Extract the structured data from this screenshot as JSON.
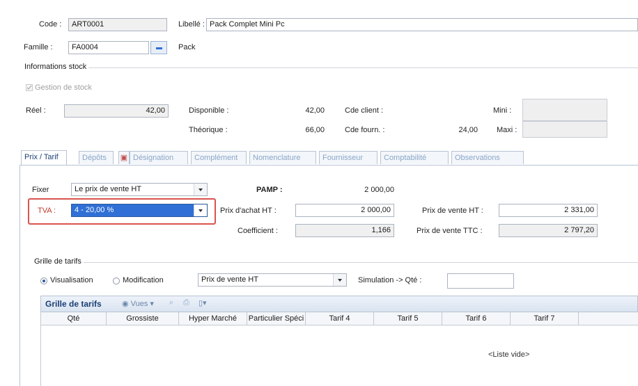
{
  "header": {
    "code_label": "Code :",
    "code_value": "ART0001",
    "libelle_label": "Libellé :",
    "libelle_value": "Pack Complet Mini Pc",
    "famille_label": "Famille :",
    "famille_value": "FA0004",
    "famille_name": "Pack"
  },
  "stock": {
    "title": "Informations stock",
    "gestion_label": "Gestion de stock",
    "reel_label": "Réel :",
    "reel_value": "42,00",
    "disponible_label": "Disponible :",
    "disponible_value": "42,00",
    "theorique_label": "Théorique :",
    "theorique_value": "66,00",
    "cde_client_label": "Cde client :",
    "cde_client_value": "",
    "cde_fourn_label": "Cde fourn. :",
    "cde_fourn_value": "24,00",
    "mini_label": "Mini :",
    "maxi_label": "Maxi :"
  },
  "tabs": [
    "Prix / Tarif",
    "Dépôts",
    "Désignation",
    "Complément",
    "Nomenclature",
    "Fournisseur",
    "Comptabilité",
    "Observations"
  ],
  "prix": {
    "fixer_label": "Fixer",
    "fixer_value": "Le prix de vente HT",
    "tva_label": "TVA :",
    "tva_value": "4 - 20,00 %",
    "pamp_label": "PAMP :",
    "pamp_value": "2 000,00",
    "prix_achat_label": "Prix d'achat HT :",
    "prix_achat_value": "2 000,00",
    "coef_label": "Coefficient :",
    "coef_value": "1,166",
    "pv_ht_label": "Prix de vente HT :",
    "pv_ht_value": "2 331,00",
    "pv_ttc_label": "Prix de vente TTC :",
    "pv_ttc_value": "2 797,20"
  },
  "grille": {
    "title": "Grille de tarifs",
    "visualisation_label": "Visualisation",
    "modification_label": "Modification",
    "mode_combo_value": "Prix de vente HT",
    "simulation_label": "Simulation -> Qté :",
    "toolbar_title": "Grille de tarifs",
    "vues_label": "Vues",
    "columns": [
      "Qté",
      "Grossiste",
      "Hyper Marché",
      "Particulier Spéci",
      "Tarif 4",
      "Tarif 5",
      "Tarif 6",
      "Tarif 7"
    ],
    "empty_text": "<Liste vide>"
  },
  "colors": {
    "accent": "#2f6fd6",
    "highlight_border": "#d9534f",
    "tab_active_text": "#1a3e73"
  }
}
